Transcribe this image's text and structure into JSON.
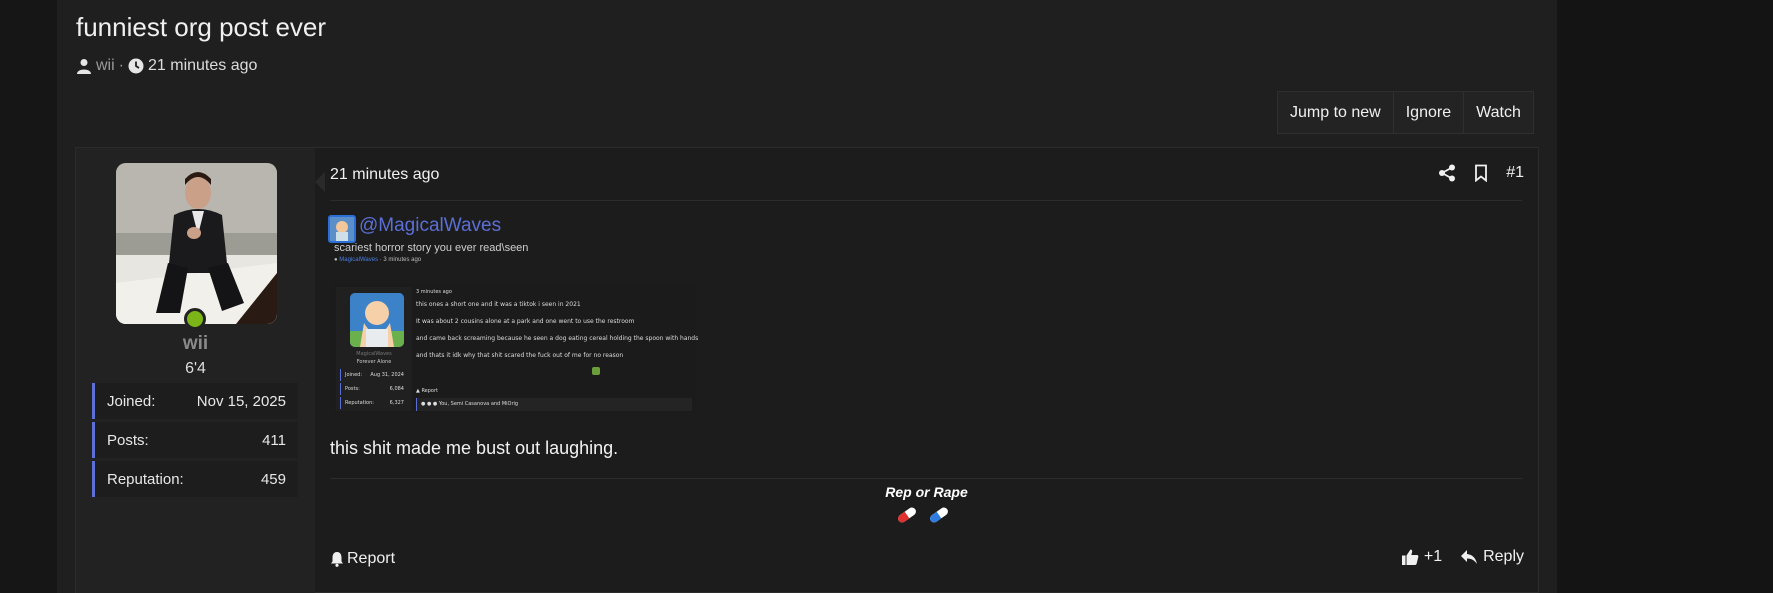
{
  "thread": {
    "title": "funniest org post ever",
    "author": "wii",
    "separator": "·",
    "time_ago": "21 minutes ago"
  },
  "thread_actions": {
    "jump_to_new": "Jump to new",
    "ignore": "Ignore",
    "watch": "Watch"
  },
  "post": {
    "user": {
      "name": "wii",
      "title": "6'4",
      "online": true,
      "stats": [
        {
          "label": "Joined:",
          "value": "Nov 15, 2025"
        },
        {
          "label": "Posts:",
          "value": "411"
        },
        {
          "label": "Reputation:",
          "value": "459"
        }
      ]
    },
    "time": "21 minutes ago",
    "number": "#1",
    "embed": {
      "mention": "@MagicalWaves",
      "subtitle": "scariest horror story you ever read\\seen",
      "meta_author": "MagicalWaves",
      "meta_time": "· 3 minutes ago",
      "card": {
        "user_name": "MagicalWaves",
        "user_title": "Forever Alone",
        "stats": [
          {
            "label": "Joined:",
            "value": "Aug 31, 2024"
          },
          {
            "label": "Posts:",
            "value": "6,084"
          },
          {
            "label": "Reputation:",
            "value": "6,327"
          }
        ],
        "time": "3 minutes ago",
        "lines": [
          "this ones a short one and it was a tiktok i seen in 2021",
          "It was about 2 cousins alone at a park and one went to use the restroom",
          "and came back screaming because he seen a dog eating cereal holding the spoon with hands",
          "and thats it idk why that shit scared the fuck out of me for no reason"
        ],
        "report": "Report",
        "reactions": "You, Semi Casanova and MiOrig"
      }
    },
    "body": "this shit made me bust out laughing.",
    "signature": "Rep or Rape",
    "footer": {
      "report": "Report",
      "like_count": "+1",
      "reply": "Reply"
    }
  },
  "colors": {
    "accent": "#5b6fd6",
    "online": "#7cb518",
    "background": "#1f1f1f"
  },
  "icons": [
    "user-icon",
    "clock-icon",
    "share-icon",
    "bookmark-icon",
    "bell-icon",
    "thumbs-up-icon",
    "reply-icon",
    "pill-icon"
  ]
}
